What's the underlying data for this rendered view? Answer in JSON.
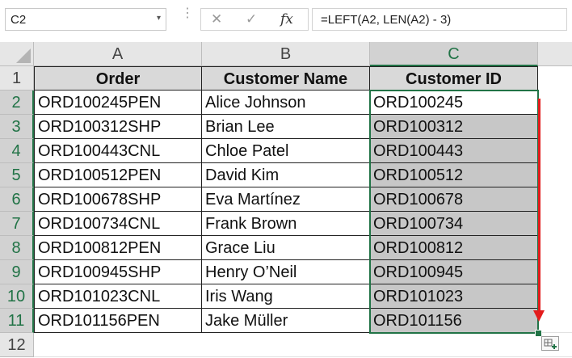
{
  "formula_bar": {
    "name_box": "C2",
    "name_box_arrow": "▾",
    "separator": "⋮",
    "cancel_icon": "✕",
    "enter_icon": "✓",
    "function_icon": "fx",
    "formula": "=LEFT(A2, LEN(A2) - 3)"
  },
  "columns": [
    "A",
    "B",
    "C"
  ],
  "rows": [
    "1",
    "2",
    "3",
    "4",
    "5",
    "6",
    "7",
    "8",
    "9",
    "10",
    "11",
    "12"
  ],
  "table": {
    "headers": [
      "Order",
      "Customer Name",
      "Customer ID"
    ],
    "data": [
      [
        "ORD100245PEN",
        "Alice Johnson",
        "ORD100245"
      ],
      [
        "ORD100312SHP",
        "Brian Lee",
        "ORD100312"
      ],
      [
        "ORD100443CNL",
        "Chloe Patel",
        "ORD100443"
      ],
      [
        "ORD100512PEN",
        "David Kim",
        "ORD100512"
      ],
      [
        "ORD100678SHP",
        "Eva Martínez",
        "ORD100678"
      ],
      [
        "ORD100734CNL",
        "Frank Brown",
        "ORD100734"
      ],
      [
        "ORD100812PEN",
        "Grace Liu",
        "ORD100812"
      ],
      [
        "ORD100945SHP",
        "Henry O’Neil",
        "ORD100945"
      ],
      [
        "ORD101023CNL",
        "Iris Wang",
        "ORD101023"
      ],
      [
        "ORD101156PEN",
        "Jake Müller",
        "ORD101156"
      ]
    ]
  },
  "colors": {
    "selection": "#217346",
    "arrow": "#e31c1c",
    "header_fill": "#d9d9d9",
    "selected_fill": "#c7c7c7"
  },
  "icons": {
    "select_all": "select-all-triangle",
    "quick_analysis": "quick-analysis-icon"
  }
}
